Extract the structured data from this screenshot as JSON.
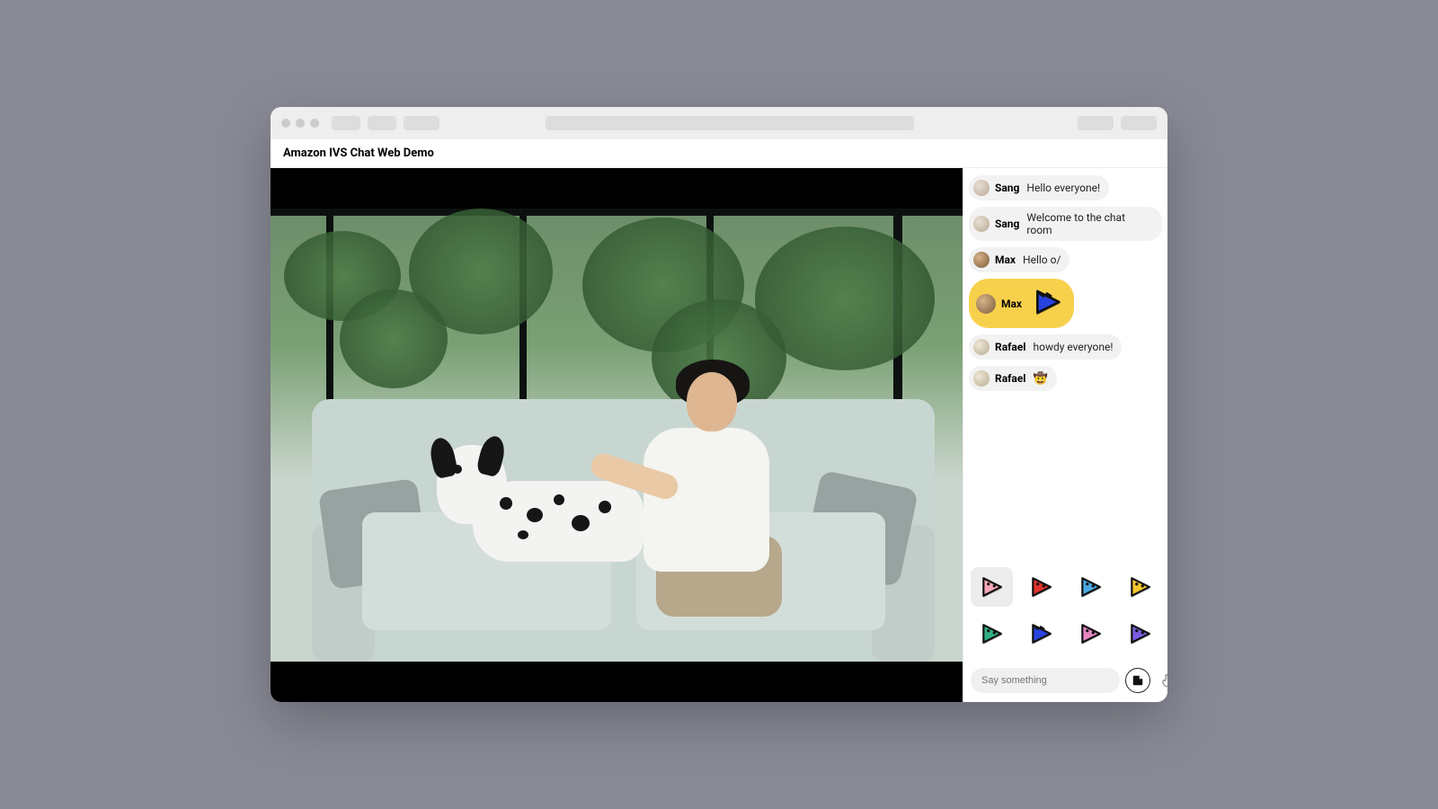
{
  "header": {
    "title": "Amazon IVS Chat Web Demo"
  },
  "chat": {
    "messages": [
      {
        "user": "Sang",
        "avatar": "sang",
        "text": "Hello everyone!",
        "highlight": false,
        "sticker": null,
        "emoji": null
      },
      {
        "user": "Sang",
        "avatar": "sang",
        "text": "Welcome to the chat room",
        "highlight": false,
        "sticker": null,
        "emoji": null
      },
      {
        "user": "Max",
        "avatar": "max",
        "text": "Hello o/",
        "highlight": false,
        "sticker": null,
        "emoji": null
      },
      {
        "user": "Max",
        "avatar": "max",
        "text": "",
        "highlight": true,
        "sticker": "blue-cool",
        "emoji": null
      },
      {
        "user": "Rafael",
        "avatar": "raf",
        "text": "howdy everyone!",
        "highlight": false,
        "sticker": null,
        "emoji": null
      },
      {
        "user": "Rafael",
        "avatar": "raf",
        "text": "",
        "highlight": false,
        "sticker": null,
        "emoji": "🤠"
      }
    ],
    "stickers": [
      {
        "id": "pink",
        "color": "#f5a8b8",
        "selected": true
      },
      {
        "id": "red",
        "color": "#e0322e",
        "selected": false
      },
      {
        "id": "skyblue",
        "color": "#4aa8e0",
        "selected": false
      },
      {
        "id": "yellow",
        "color": "#f3c72c",
        "selected": false
      },
      {
        "id": "teal",
        "color": "#2fae84",
        "selected": false
      },
      {
        "id": "blue-cool",
        "color": "#2743e0",
        "selected": false
      },
      {
        "id": "pink2",
        "color": "#e887c3",
        "selected": false
      },
      {
        "id": "purple",
        "color": "#7a5be0",
        "selected": false
      }
    ],
    "composer": {
      "placeholder": "Say something",
      "value": ""
    }
  }
}
